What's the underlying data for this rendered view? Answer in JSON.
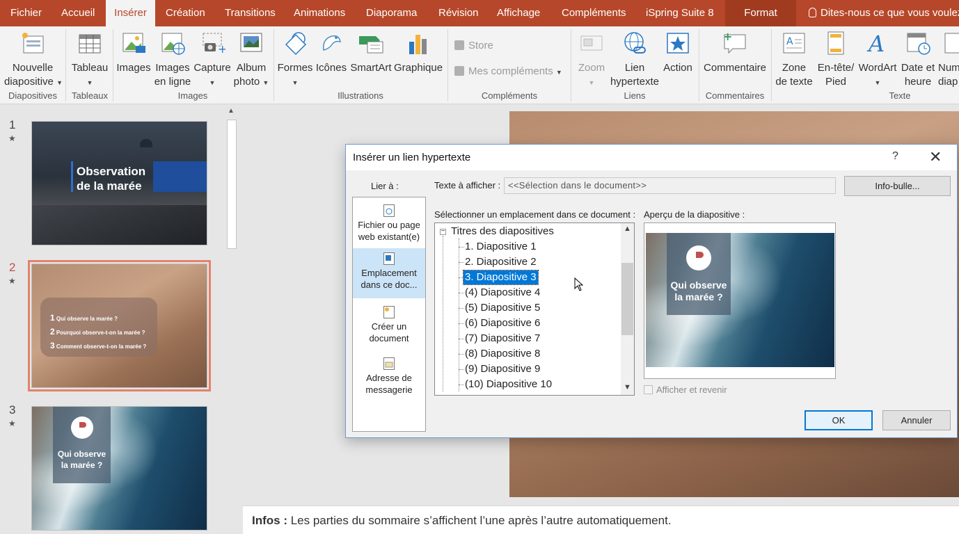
{
  "ribbon_tabs": [
    {
      "label": "Fichier"
    },
    {
      "label": "Accueil"
    },
    {
      "label": "Insérer"
    },
    {
      "label": "Création"
    },
    {
      "label": "Transitions"
    },
    {
      "label": "Animations"
    },
    {
      "label": "Diaporama"
    },
    {
      "label": "Révision"
    },
    {
      "label": "Affichage"
    },
    {
      "label": "Compléments"
    },
    {
      "label": "iSpring Suite 8"
    },
    {
      "label": "Format"
    }
  ],
  "tell_me": "Dites-nous ce que vous voulez",
  "ribbon": {
    "nouvelle_diapositive": [
      "Nouvelle",
      "diapositive"
    ],
    "tableau": "Tableau",
    "images": "Images",
    "images_en_ligne": [
      "Images",
      "en ligne"
    ],
    "capture": "Capture",
    "album_photo": [
      "Album",
      "photo"
    ],
    "formes": "Formes",
    "icones": "Icônes",
    "smartart": "SmartArt",
    "graphique": "Graphique",
    "store": "Store",
    "mes_complements": "Mes compléments",
    "zoom": "Zoom",
    "lien_hypertexte": [
      "Lien",
      "hypertexte"
    ],
    "action": "Action",
    "commentaire": "Commentaire",
    "zone_de_texte": [
      "Zone",
      "de texte"
    ],
    "en_tete_pied": [
      "En-tête/",
      "Pied"
    ],
    "wordart": "WordArt",
    "date_heure": [
      "Date et",
      "heure"
    ],
    "num_diapo": [
      "Num",
      "diap"
    ],
    "groups": {
      "diapositives": "Diapositives",
      "tableaux": "Tableaux",
      "images": "Images",
      "illustrations": "Illustrations",
      "complements": "Compléments",
      "liens": "Liens",
      "commentaires": "Commentaires",
      "texte": "Texte"
    }
  },
  "thumbnails": [
    {
      "number": "1",
      "title_line1": "Observation",
      "title_line2": "de la marée"
    },
    {
      "number": "2",
      "items": [
        {
          "n": "1",
          "text": "Qui observe la marée ?"
        },
        {
          "n": "2",
          "text": "Pourquoi observe-t-on la marée ?"
        },
        {
          "n": "3",
          "text": "Comment observe-t-on la marée ?"
        }
      ]
    },
    {
      "number": "3",
      "line1": "Qui observe",
      "line2": "la marée ?"
    }
  ],
  "star": "★",
  "notes": {
    "label": "Infos :",
    "text": " Les parties du sommaire s’affichent l’une après l’autre automatiquement."
  },
  "dialog": {
    "title": "Insérer un lien hypertexte",
    "help": "?",
    "close": "✕",
    "lier_a": "Lier à :",
    "link_types": [
      {
        "line1": "Fichier ou page",
        "line2": "web existant(e)"
      },
      {
        "line1": "Emplacement",
        "line2": "dans ce doc..."
      },
      {
        "line1": "Créer un",
        "line2": "document"
      },
      {
        "line1": "Adresse de",
        "line2": "messagerie"
      }
    ],
    "texte_a_afficher_label": "Texte à afficher :",
    "texte_a_afficher_value": "<<Sélection dans le document>>",
    "infobulle": "Info-bulle...",
    "select_label": "Sélectionner un emplacement dans ce document :",
    "tree_root": "Titres des diapositives",
    "tree_items": [
      "1. Diapositive 1",
      "2. Diapositive 2",
      "3. Diapositive 3",
      "(4) Diapositive 4",
      "(5) Diapositive 5",
      "(6) Diapositive 6",
      "(7) Diapositive 7",
      "(8) Diapositive 8",
      "(9) Diapositive 9",
      "(10) Diapositive 10"
    ],
    "selected_index": 2,
    "apercu_label": "Aperçu de la diapositive :",
    "apercu_line1": "Qui observe",
    "apercu_line2": "la marée ?",
    "afficher_et_revenir": "Afficher et revenir",
    "ok": "OK",
    "annuler": "Annuler"
  },
  "colors": {
    "accent": "#b7472a",
    "selection": "#0078d7"
  }
}
